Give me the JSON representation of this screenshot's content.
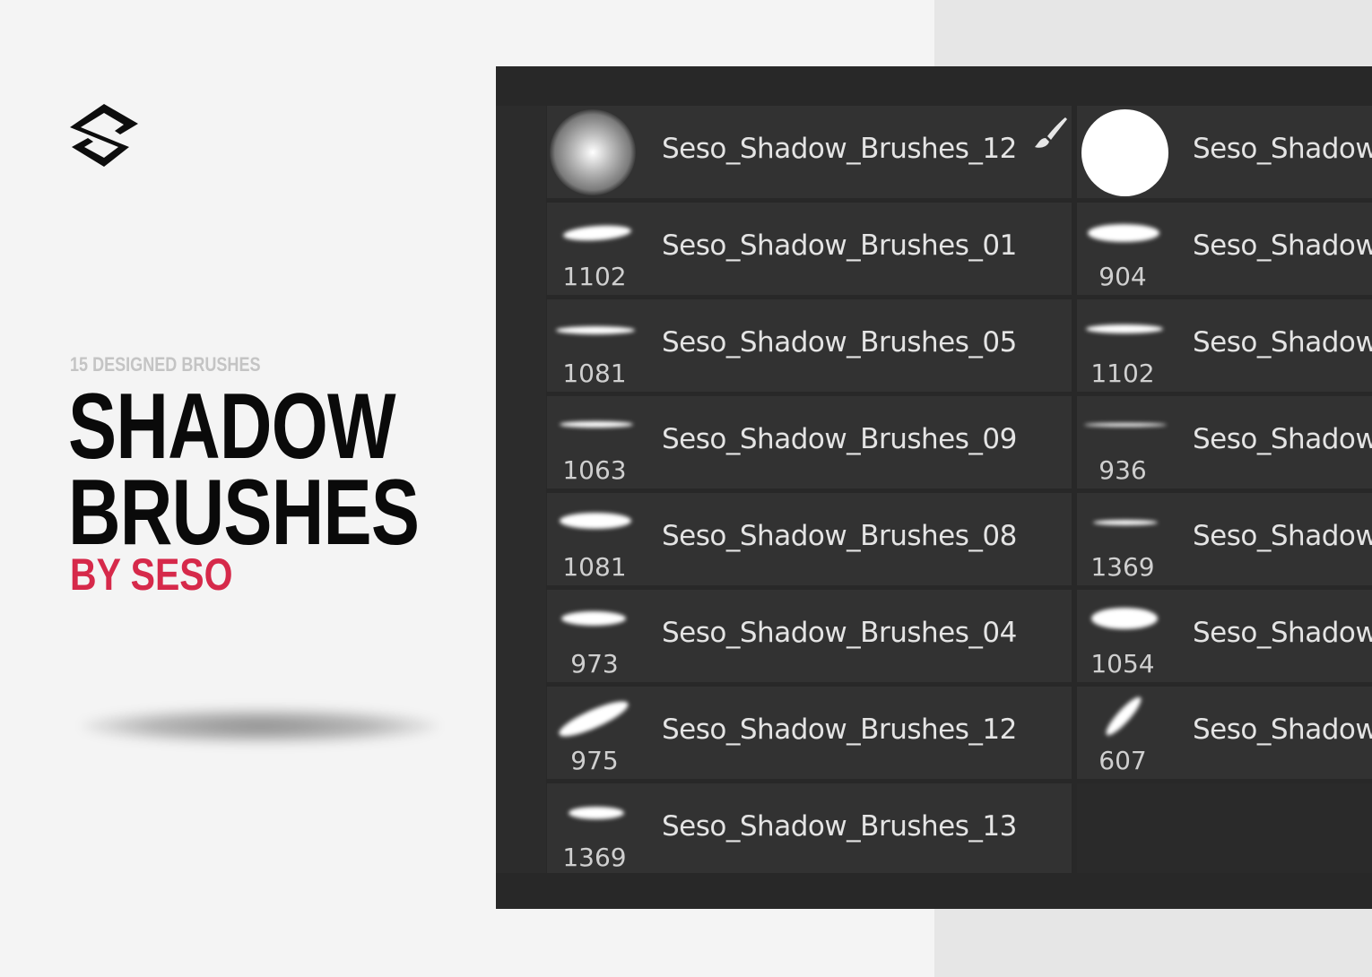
{
  "promo": {
    "kicker": "15 DESIGNED BRUSHES",
    "title_line1": "SHADOW",
    "title_line2": "BRUSHES",
    "byline": "BY SESO",
    "accent_color": "#d6294a",
    "logo_icon": "seso-s-logo-icon"
  },
  "brush_panel": {
    "left_column": [
      {
        "name": "Seso_Shadow_Brushes_12",
        "size": "",
        "thumb": "soft-round",
        "selected_tool_icon": "brush-tool-icon"
      },
      {
        "name": "Seso_Shadow_Brushes_01",
        "size": "1102",
        "thumb": "stroke"
      },
      {
        "name": "Seso_Shadow_Brushes_05",
        "size": "1081",
        "thumb": "stroke"
      },
      {
        "name": "Seso_Shadow_Brushes_09",
        "size": "1063",
        "thumb": "stroke"
      },
      {
        "name": "Seso_Shadow_Brushes_08",
        "size": "1081",
        "thumb": "stroke"
      },
      {
        "name": "Seso_Shadow_Brushes_04",
        "size": "973",
        "thumb": "stroke"
      },
      {
        "name": "Seso_Shadow_Brushes_12",
        "size": "975",
        "thumb": "stroke"
      },
      {
        "name": "Seso_Shadow_Brushes_13",
        "size": "1369",
        "thumb": "stroke"
      }
    ],
    "right_column": [
      {
        "name": "Seso_Shadow_",
        "size": "",
        "thumb": "hard-round"
      },
      {
        "name": "Seso_Shadow_",
        "size": "904",
        "thumb": "stroke"
      },
      {
        "name": "Seso_Shadow_",
        "size": "1102",
        "thumb": "stroke"
      },
      {
        "name": "Seso_Shadow_",
        "size": "936",
        "thumb": "stroke"
      },
      {
        "name": "Seso_Shadow_",
        "size": "1369",
        "thumb": "stroke"
      },
      {
        "name": "Seso_Shadow_",
        "size": "1054",
        "thumb": "stroke"
      },
      {
        "name": "Seso_Shadow_",
        "size": "607",
        "thumb": "stroke"
      }
    ]
  }
}
